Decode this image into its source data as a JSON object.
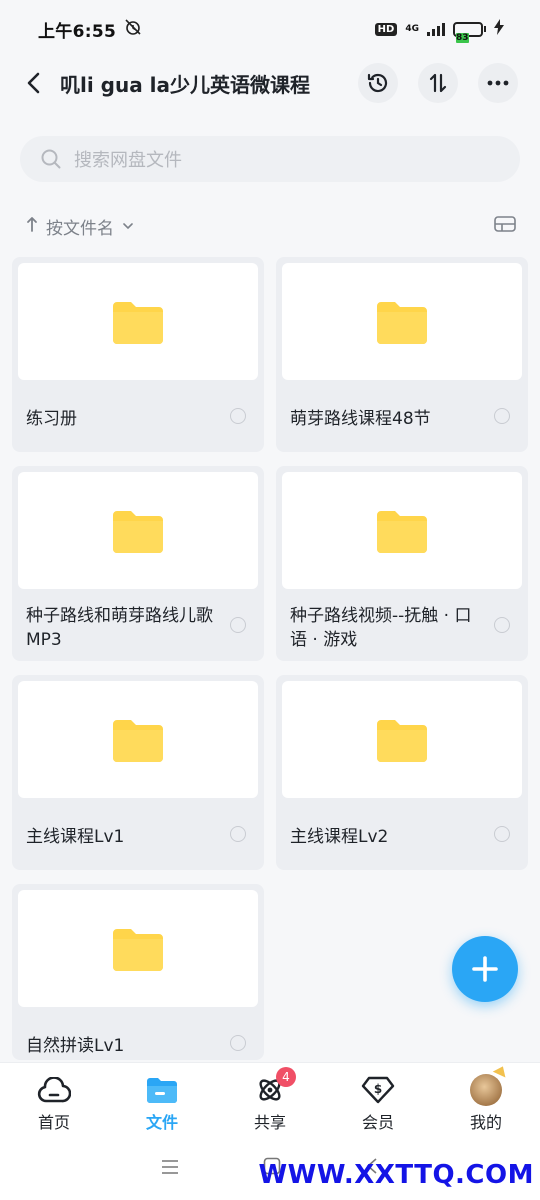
{
  "status_bar": {
    "time": "上午6:55",
    "hd": "HD",
    "network": "4G",
    "battery": "83",
    "battery_level": 0.83
  },
  "header": {
    "title": "叽li gua la少儿英语微课程",
    "back_icon": "chevron-left-icon",
    "actions": [
      "history-icon",
      "sort-transfer-icon",
      "more-icon"
    ]
  },
  "search": {
    "placeholder": "搜索网盘文件"
  },
  "sort": {
    "label": "按文件名"
  },
  "folders": [
    {
      "name": "练习册"
    },
    {
      "name": "萌芽路线课程48节"
    },
    {
      "name": "种子路线和萌芽路线儿歌MP3"
    },
    {
      "name": "种子路线视频--抚触 · 口语 · 游戏"
    },
    {
      "name": "主线课程Lv1"
    },
    {
      "name": "主线课程Lv2"
    },
    {
      "name": "自然拼读Lv1"
    }
  ],
  "bottom_nav": {
    "items": [
      {
        "label": "首页",
        "icon": "cloud-home-icon"
      },
      {
        "label": "文件",
        "icon": "folder-icon"
      },
      {
        "label": "共享",
        "icon": "share-atom-icon",
        "badge": "4"
      },
      {
        "label": "会员",
        "icon": "vip-dollar-icon"
      },
      {
        "label": "我的",
        "icon": "avatar"
      }
    ]
  },
  "watermark": "WWW.XXTTQ.COM",
  "colors": {
    "accent": "#2aa6f5",
    "folder": "#ffd54a",
    "badge": "#f04f66"
  }
}
